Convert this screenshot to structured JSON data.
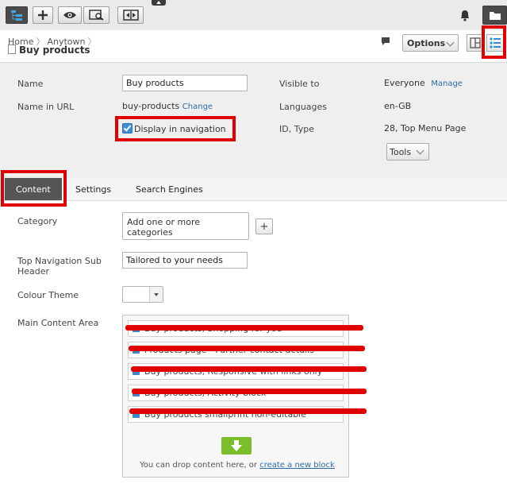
{
  "header": {
    "breadcrumb": [
      "Home",
      "Anytown"
    ],
    "page_title": "Buy products",
    "options_label": "Options"
  },
  "properties": {
    "name_label": "Name",
    "name_value": "Buy products",
    "url_label": "Name in URL",
    "url_value": "buy-products",
    "change_link": "Change",
    "display_nav_label": "Display in navigation",
    "visible_label": "Visible to",
    "visible_value": "Everyone",
    "manage_link": "Manage",
    "languages_label": "Languages",
    "languages_value": "en-GB",
    "id_type_label": "ID, Type",
    "id_type_value": "28, Top Menu Page",
    "tools_label": "Tools"
  },
  "tabs": [
    {
      "label": "Content",
      "active": true
    },
    {
      "label": "Settings",
      "active": false
    },
    {
      "label": "Search Engines",
      "active": false
    }
  ],
  "content": {
    "category_label": "Category",
    "category_placeholder": "Add one or more categories",
    "top_nav_label": "Top Navigation Sub Header",
    "top_nav_value": "Tailored to your needs",
    "colour_theme_label": "Colour Theme",
    "main_content_label": "Main Content Area",
    "blocks": [
      "Buy products, Shopping for you",
      "Products page - Further contact details",
      "Buy products, Responsive with links only",
      "Buy products, Activity block",
      "Buy products smallprint non-editable"
    ],
    "drop_text": "You can drop content here, or",
    "create_block_link": "create a new block"
  },
  "colors": {
    "annotation_red": "#e00000",
    "link_blue": "#2f6da3",
    "drop_green": "#7cbd2c",
    "checkbox_blue": "#3c8fd4"
  }
}
